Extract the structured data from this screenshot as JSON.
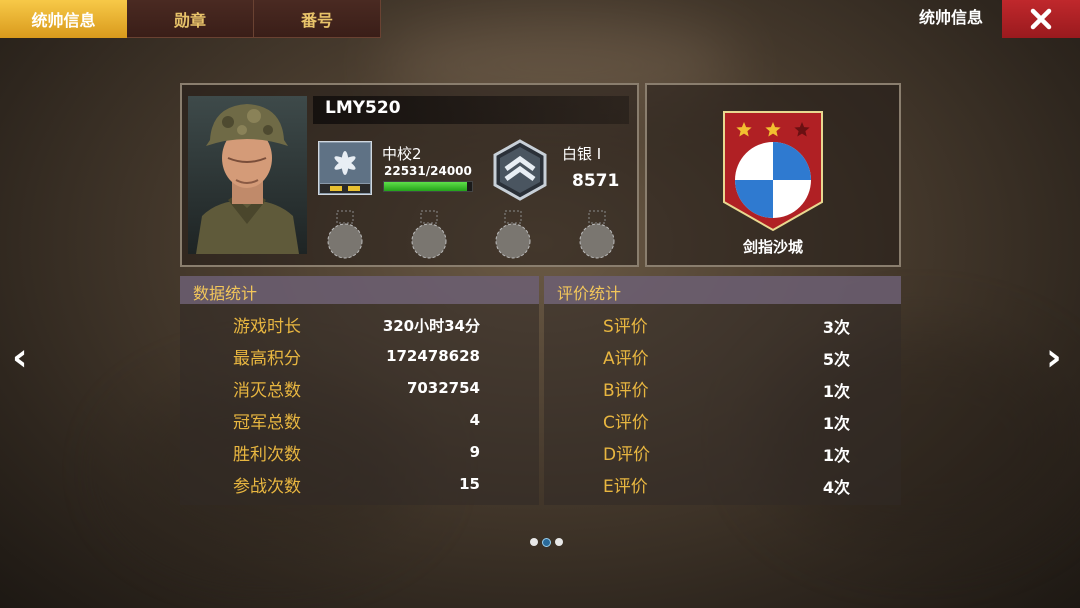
{
  "tabs": [
    {
      "label": "统帅信息",
      "active": true
    },
    {
      "label": "勋章",
      "active": false
    },
    {
      "label": "番号",
      "active": false
    }
  ],
  "header": {
    "title": "统帅信息"
  },
  "commander": {
    "name": "LMY520",
    "rank": "中校2",
    "xp": "22531/24000",
    "xp_fraction": 0.939,
    "tier": "白银 I",
    "points": "8571",
    "clan": "剑指沙城",
    "clan_stars_filled": 2,
    "clan_stars_total": 3
  },
  "data_stats": {
    "title": "数据统计",
    "rows": [
      {
        "label": "游戏时长",
        "value": "320小时34分"
      },
      {
        "label": "最高积分",
        "value": "172478628"
      },
      {
        "label": "消灭总数",
        "value": "7032754"
      },
      {
        "label": "冠军总数",
        "value": "4"
      },
      {
        "label": "胜利次数",
        "value": "9"
      },
      {
        "label": "参战次数",
        "value": "15"
      }
    ]
  },
  "rating_stats": {
    "title": "评价统计",
    "rows": [
      {
        "label": "S评价",
        "value": "3次"
      },
      {
        "label": "A评价",
        "value": "5次"
      },
      {
        "label": "B评价",
        "value": "1次"
      },
      {
        "label": "C评价",
        "value": "1次"
      },
      {
        "label": "D评价",
        "value": "1次"
      },
      {
        "label": "E评价",
        "value": "4次"
      }
    ]
  },
  "nav": {
    "prev": "‹",
    "next": "›"
  },
  "pagination": {
    "count": 3,
    "active_index": 1
  },
  "colors": {
    "accent_gold": "#e8b640",
    "tab_active": "#f2b832",
    "close_red": "#b02024",
    "xp_green": "#3fc62e"
  }
}
